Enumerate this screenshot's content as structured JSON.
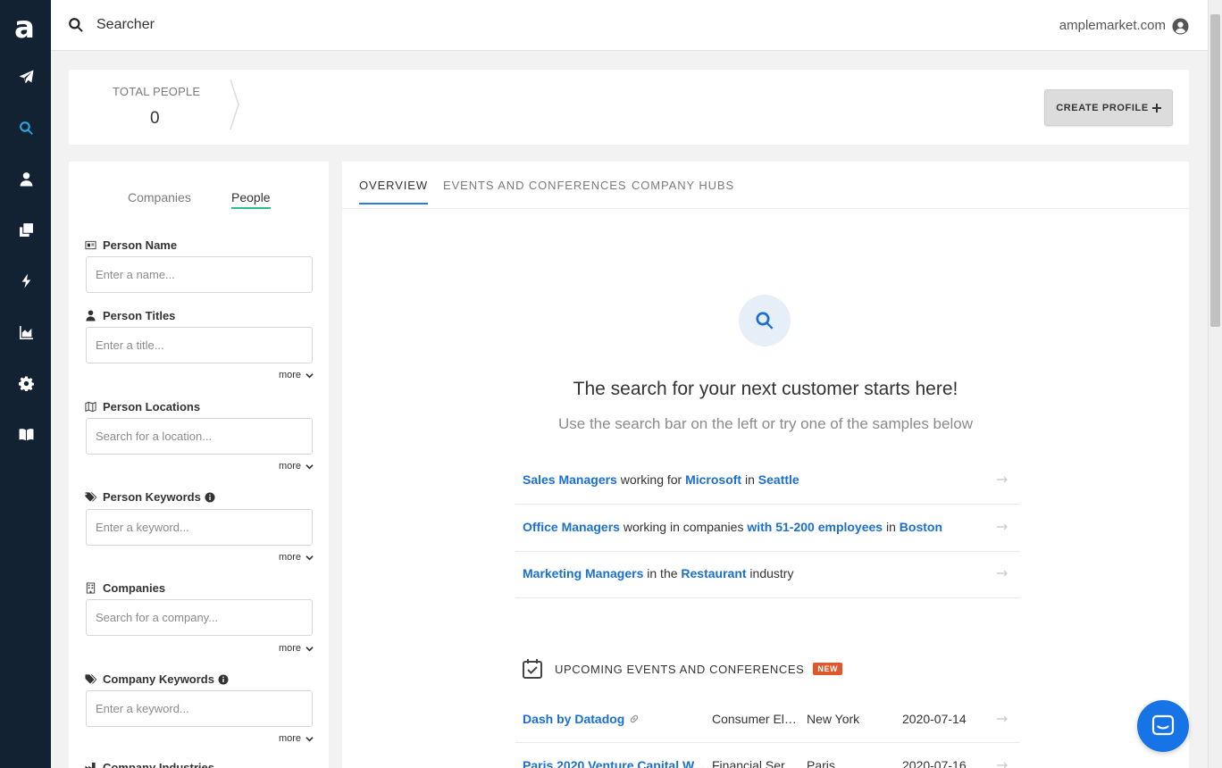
{
  "app": {
    "logo": "a"
  },
  "topbar": {
    "title": "Searcher",
    "domain": "amplemarket.com"
  },
  "sidebar": {
    "items": [
      {
        "icon": "paper-plane-icon"
      },
      {
        "icon": "search-icon",
        "active": true
      },
      {
        "icon": "user-icon"
      },
      {
        "icon": "copy-icon"
      },
      {
        "icon": "bolt-icon"
      },
      {
        "icon": "area-chart-icon"
      },
      {
        "icon": "gear-icon"
      },
      {
        "icon": "book-icon"
      }
    ]
  },
  "stats": {
    "label": "TOTAL PEOPLE",
    "value": "0",
    "create_button": "CREATE PROFILE"
  },
  "filters": {
    "tabs": {
      "companies": "Companies",
      "people": "People"
    },
    "more_label": "more",
    "person_name": {
      "label": "Person Name",
      "placeholder": "Enter a name..."
    },
    "person_titles": {
      "label": "Person Titles",
      "placeholder": "Enter a title..."
    },
    "person_locations": {
      "label": "Person Locations",
      "placeholder": "Search for a location..."
    },
    "person_keywords": {
      "label": "Person Keywords",
      "placeholder": "Enter a keyword..."
    },
    "companies": {
      "label": "Companies",
      "placeholder": "Search for a company..."
    },
    "company_keywords": {
      "label": "Company Keywords",
      "placeholder": "Enter a keyword..."
    },
    "company_industries": {
      "label": "Company Industries"
    }
  },
  "main": {
    "tabs": [
      "OVERVIEW",
      "EVENTS AND CONFERENCES",
      "COMPANY HUBS"
    ],
    "hero_title": "The search for your next customer starts here!",
    "hero_subtitle": "Use the search bar on the left or try one of the samples below",
    "samples": [
      {
        "p1": "Sales Managers",
        "t1": " working for ",
        "p2": "Microsoft",
        "t2": " in ",
        "p3": "Seattle",
        "t3": ""
      },
      {
        "p1": "Office Managers",
        "t1": " working in companies ",
        "p2": "with 51-200 employees",
        "t2": " in ",
        "p3": "Boston",
        "t3": ""
      },
      {
        "p1": "Marketing Managers",
        "t1": " in the ",
        "p2": "Restaurant",
        "t2": " industry",
        "p3": "",
        "t3": ""
      }
    ],
    "events_title": "UPCOMING EVENTS AND CONFERENCES",
    "events_badge": "NEW",
    "events": [
      {
        "name": "Dash by Datadog",
        "category": "Consumer Electronics",
        "city": "New York",
        "date": "2020-07-14"
      },
      {
        "name": "Paris 2020 Venture Capital W...",
        "category": "Financial Services",
        "city": "Paris",
        "date": "2020-07-16"
      }
    ]
  }
}
